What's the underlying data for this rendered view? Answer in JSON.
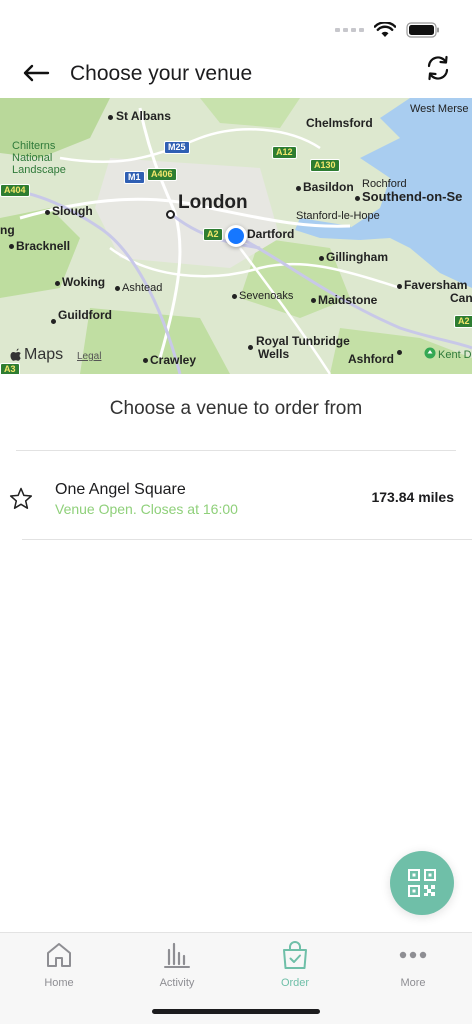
{
  "header": {
    "title": "Choose your venue"
  },
  "map": {
    "labels": {
      "st_albans": "St Albans",
      "chelmsford": "Chelmsford",
      "west_mersea": "West Merse",
      "chilterns": "Chilterns",
      "national": "National",
      "landscape": "Landscape",
      "basildon": "Basildon",
      "rochford": "Rochford",
      "southend": "Southend-on-Se",
      "slough": "Slough",
      "london": "London",
      "stanford": "Stanford-le-Hope",
      "dartford": "Dartford",
      "ng": "ng",
      "bracknell": "Bracknell",
      "gillingham": "Gillingham",
      "woking": "Woking",
      "ashtead": "Ashtead",
      "faversham": "Faversham",
      "can": "Can",
      "sevenoaks": "Sevenoaks",
      "maidstone": "Maidstone",
      "guildford": "Guildford",
      "royal_tunbridge": "Royal Tunbridge",
      "wells": "Wells",
      "crawley": "Crawley",
      "ashford": "Ashford",
      "kent_d": "Kent D"
    },
    "shields": {
      "m25": "M25",
      "a12": "A12",
      "a130": "A130",
      "m1": "M1",
      "a406": "A406",
      "a404": "A404",
      "a2_left": "A2",
      "a2_right": "A2",
      "a3": "A3"
    },
    "maps_brand": "Maps",
    "legal": "Legal"
  },
  "section": {
    "title": "Choose a venue to order from"
  },
  "venues": [
    {
      "name": "One Angel Square",
      "status": "Venue Open. Closes at 16:00",
      "distance": "173.84 miles"
    }
  ],
  "tabs": [
    {
      "label": "Home"
    },
    {
      "label": "Activity"
    },
    {
      "label": "Order"
    },
    {
      "label": "More"
    }
  ],
  "colors": {
    "accent": "#6fbfa8",
    "open_status": "#8fd07a",
    "location_blue": "#1677ff"
  }
}
